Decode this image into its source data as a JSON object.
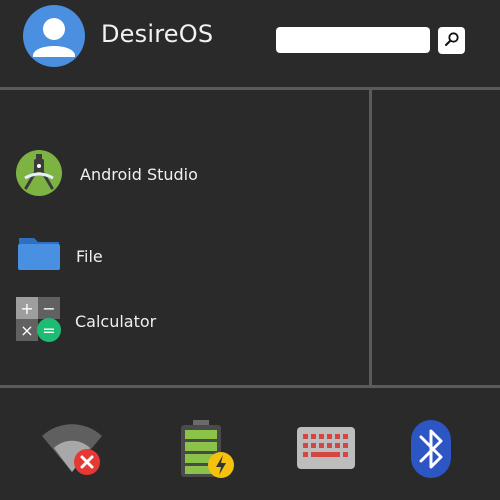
{
  "header": {
    "username": "DesireOS",
    "search": {
      "value": "",
      "placeholder": ""
    }
  },
  "icons": {
    "avatar": "user-avatar-icon",
    "search": "magnifier-icon"
  },
  "apps": [
    {
      "label": "Android Studio",
      "icon": "android-studio-icon"
    },
    {
      "label": "File",
      "icon": "folder-icon"
    },
    {
      "label": "Calculator",
      "icon": "calculator-icon"
    }
  ],
  "tray": [
    {
      "icon": "wifi-disconnected-icon"
    },
    {
      "icon": "battery-charging-icon"
    },
    {
      "icon": "keyboard-icon"
    },
    {
      "icon": "bluetooth-icon"
    }
  ],
  "colors": {
    "background": "#2a2a2a",
    "divider": "#5b5b5b",
    "avatar": "#4a8fe0",
    "android_green": "#7cb342",
    "folder_blue": "#4a90e2",
    "bluetooth_blue": "#2b56c4",
    "battery_green": "#8bc34a",
    "charge_yellow": "#f4c20d",
    "error_red": "#e53935",
    "keyboard_red": "#d64541"
  }
}
